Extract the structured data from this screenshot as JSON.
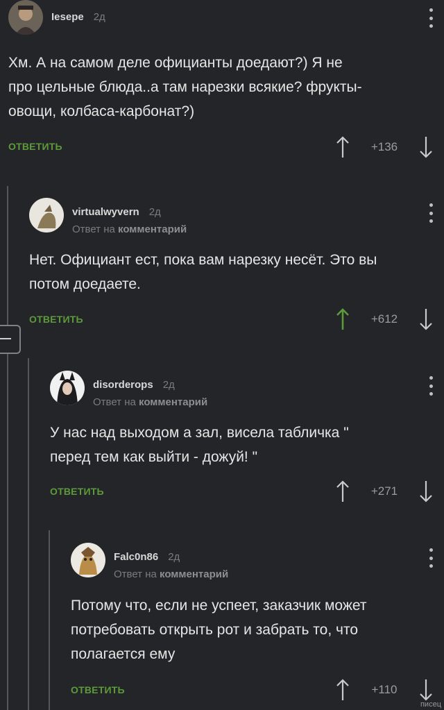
{
  "comments": [
    {
      "author": "Iesepe",
      "time": "2д",
      "reply_prefix": "",
      "reply_link": "",
      "lines": [
        "Хм. А на самом деле официанты доедают?) Я не",
        "про цельные блюда..а там нарезки всякие? фрукты-",
        "овощи, колбаса-карбонат?)"
      ],
      "reply_label": "ОТВЕТИТЬ",
      "score": "+136",
      "upvoted": false
    },
    {
      "author": "virtualwyvern",
      "time": "2д",
      "reply_prefix": "Ответ на",
      "reply_link": "комментарий",
      "lines": [
        "Нет. Официант ест, пока вам нарезку несёт. Это вы",
        "потом доедаете."
      ],
      "reply_label": "ОТВЕТИТЬ",
      "score": "+612",
      "upvoted": true
    },
    {
      "author": "disorderops",
      "time": "2д",
      "reply_prefix": "Ответ на",
      "reply_link": "комментарий",
      "lines": [
        "У нас над выходом а зал, висела табличка \"",
        "перед тем как выйти - дожуй! \""
      ],
      "reply_label": "ОТВЕТИТЬ",
      "score": "+271",
      "upvoted": false
    },
    {
      "author": "Falc0n86",
      "time": "2д",
      "reply_prefix": "Ответ на",
      "reply_link": "комментарий",
      "lines": [
        "Потому что, если не успеет, заказчик может",
        "потребовать открыть рот и забрать то, что",
        "полагается ему"
      ],
      "reply_label": "ОТВЕТИТЬ",
      "score": "+110",
      "upvoted": false
    }
  ],
  "watermark": "писец",
  "colors": {
    "background": "#242528",
    "reply_green": "#5d9a3a",
    "upvote_active": "#5d9a3a",
    "arrow_idle": "#c9cacc"
  },
  "icons": {
    "upvote": "arrow-up-icon",
    "downvote": "arrow-down-icon",
    "menu": "kebab-menu-icon",
    "collapse": "collapse-minus-icon"
  }
}
